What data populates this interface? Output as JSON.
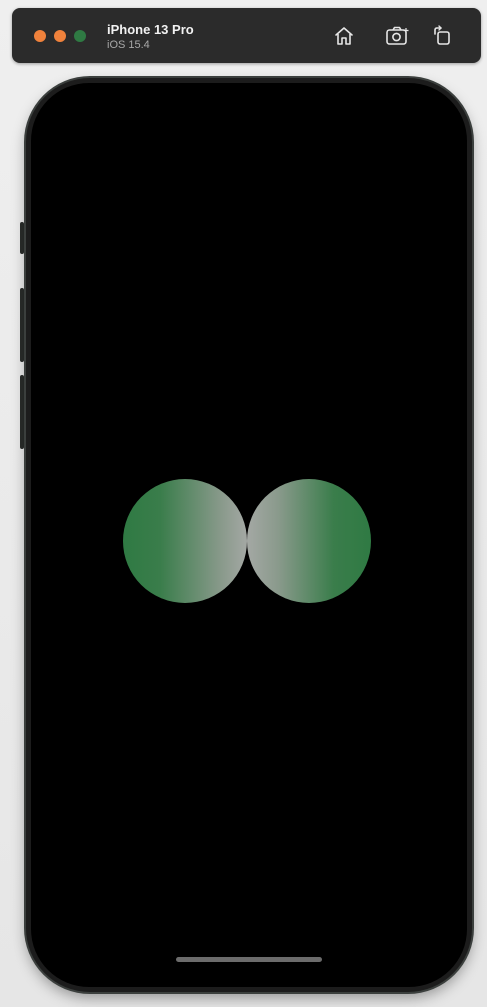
{
  "titlebar": {
    "device_name": "iPhone 13 Pro",
    "os_version": "iOS 15.4",
    "traffic_lights": [
      {
        "name": "close",
        "color": "#f0823c"
      },
      {
        "name": "minimize",
        "color": "#f0823c"
      },
      {
        "name": "zoom",
        "color": "#2f7a43"
      }
    ],
    "buttons": [
      {
        "name": "home",
        "icon": "home-icon"
      },
      {
        "name": "screenshot",
        "icon": "camera-icon"
      },
      {
        "name": "rotate",
        "icon": "rotate-icon"
      }
    ]
  },
  "screen": {
    "background": "#000000",
    "shapes": [
      {
        "name": "left-circle",
        "colors": [
          "#2f7a43",
          "#a4a8a4"
        ]
      },
      {
        "name": "right-circle",
        "colors": [
          "#a4a8a4",
          "#2f7a43"
        ]
      }
    ]
  },
  "colors": {
    "accent_green": "#2f7a43",
    "frame": "#1c1c1c",
    "titlebar": "#2b2b2b"
  }
}
